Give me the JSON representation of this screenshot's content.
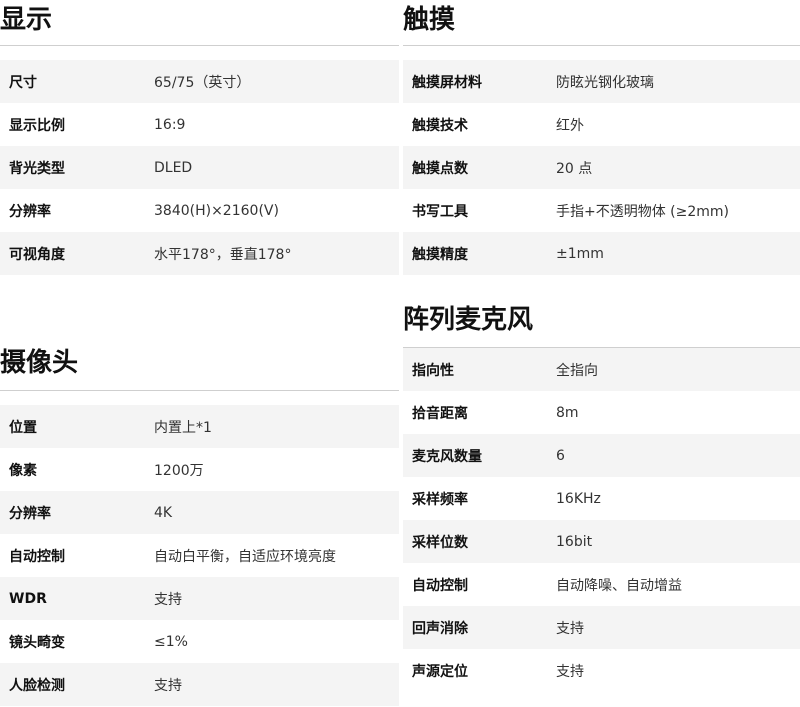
{
  "display": {
    "title": "显示",
    "rows": [
      {
        "label": "尺寸",
        "value": "65/75（英寸）"
      },
      {
        "label": "显示比例",
        "value": "16:9"
      },
      {
        "label": "背光类型",
        "value": "DLED"
      },
      {
        "label": "分辨率",
        "value": "3840(H)×2160(V)"
      },
      {
        "label": "可视角度",
        "value": "水平178°，垂直178°"
      }
    ]
  },
  "touch": {
    "title": "触摸",
    "rows": [
      {
        "label": "触摸屏材料",
        "value": "防眩光钢化玻璃"
      },
      {
        "label": "触摸技术",
        "value": "红外"
      },
      {
        "label": "触摸点数",
        "value": "20 点"
      },
      {
        "label": "书写工具",
        "value": "手指+不透明物体 (≥2mm)"
      },
      {
        "label": "触摸精度",
        "value": "±1mm"
      }
    ]
  },
  "camera": {
    "title": "摄像头",
    "rows": [
      {
        "label": "位置",
        "value": "内置上*1"
      },
      {
        "label": "像素",
        "value": "1200万"
      },
      {
        "label": "分辨率",
        "value": "4K"
      },
      {
        "label": "自动控制",
        "value": "自动白平衡，自适应环境亮度"
      },
      {
        "label": "WDR",
        "value": "支持"
      },
      {
        "label": "镜头畸变",
        "value": "≤1%"
      },
      {
        "label": "人脸检测",
        "value": "支持"
      }
    ]
  },
  "mic": {
    "title": "阵列麦克风",
    "rows": [
      {
        "label": "指向性",
        "value": "全指向"
      },
      {
        "label": "拾音距离",
        "value": "8m"
      },
      {
        "label": "麦克风数量",
        "value": "6"
      },
      {
        "label": "采样频率",
        "value": "16KHz"
      },
      {
        "label": "采样位数",
        "value": "16bit"
      },
      {
        "label": "自动控制",
        "value": "自动降噪、自动增益"
      },
      {
        "label": "回声消除",
        "value": "支持"
      },
      {
        "label": "声源定位",
        "value": "支持"
      }
    ]
  }
}
